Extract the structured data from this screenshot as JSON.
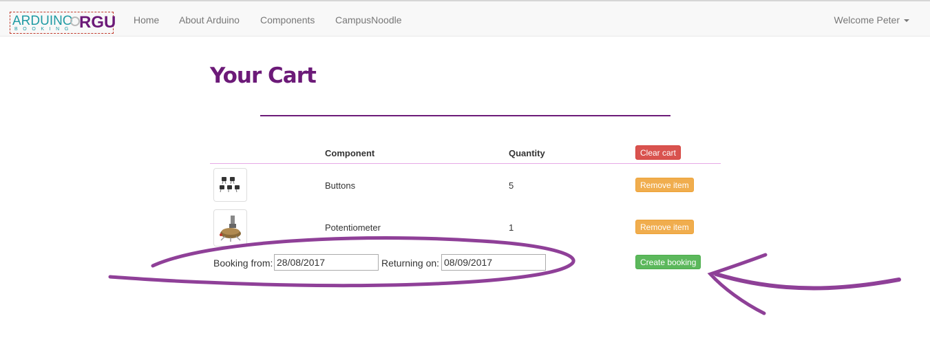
{
  "nav": {
    "logo_main": "ARDUINO",
    "logo_sub": "BOOKING",
    "logo_brand": "RGU",
    "links": [
      "Home",
      "About Arduino",
      "Components",
      "CampusNoodle"
    ],
    "user": "Welcome Peter"
  },
  "page": {
    "title": "Your Cart"
  },
  "cart": {
    "headers": {
      "component": "Component",
      "quantity": "Quantity"
    },
    "clear_label": "Clear cart",
    "remove_label": "Remove item",
    "items": [
      {
        "name": "Buttons",
        "quantity": "5",
        "image": "buttons-image"
      },
      {
        "name": "Potentiometer",
        "quantity": "1",
        "image": "potentiometer-image"
      }
    ]
  },
  "booking": {
    "from_label": "Booking from:",
    "from_value": "28/08/2017",
    "return_label": "Returning on:",
    "return_value": "08/09/2017",
    "create_label": "Create booking"
  },
  "colors": {
    "brand": "#6c1a78",
    "danger": "#d9534f",
    "warning": "#f0ad4e",
    "success": "#5cb85c",
    "annotation": "#7b1f86"
  }
}
